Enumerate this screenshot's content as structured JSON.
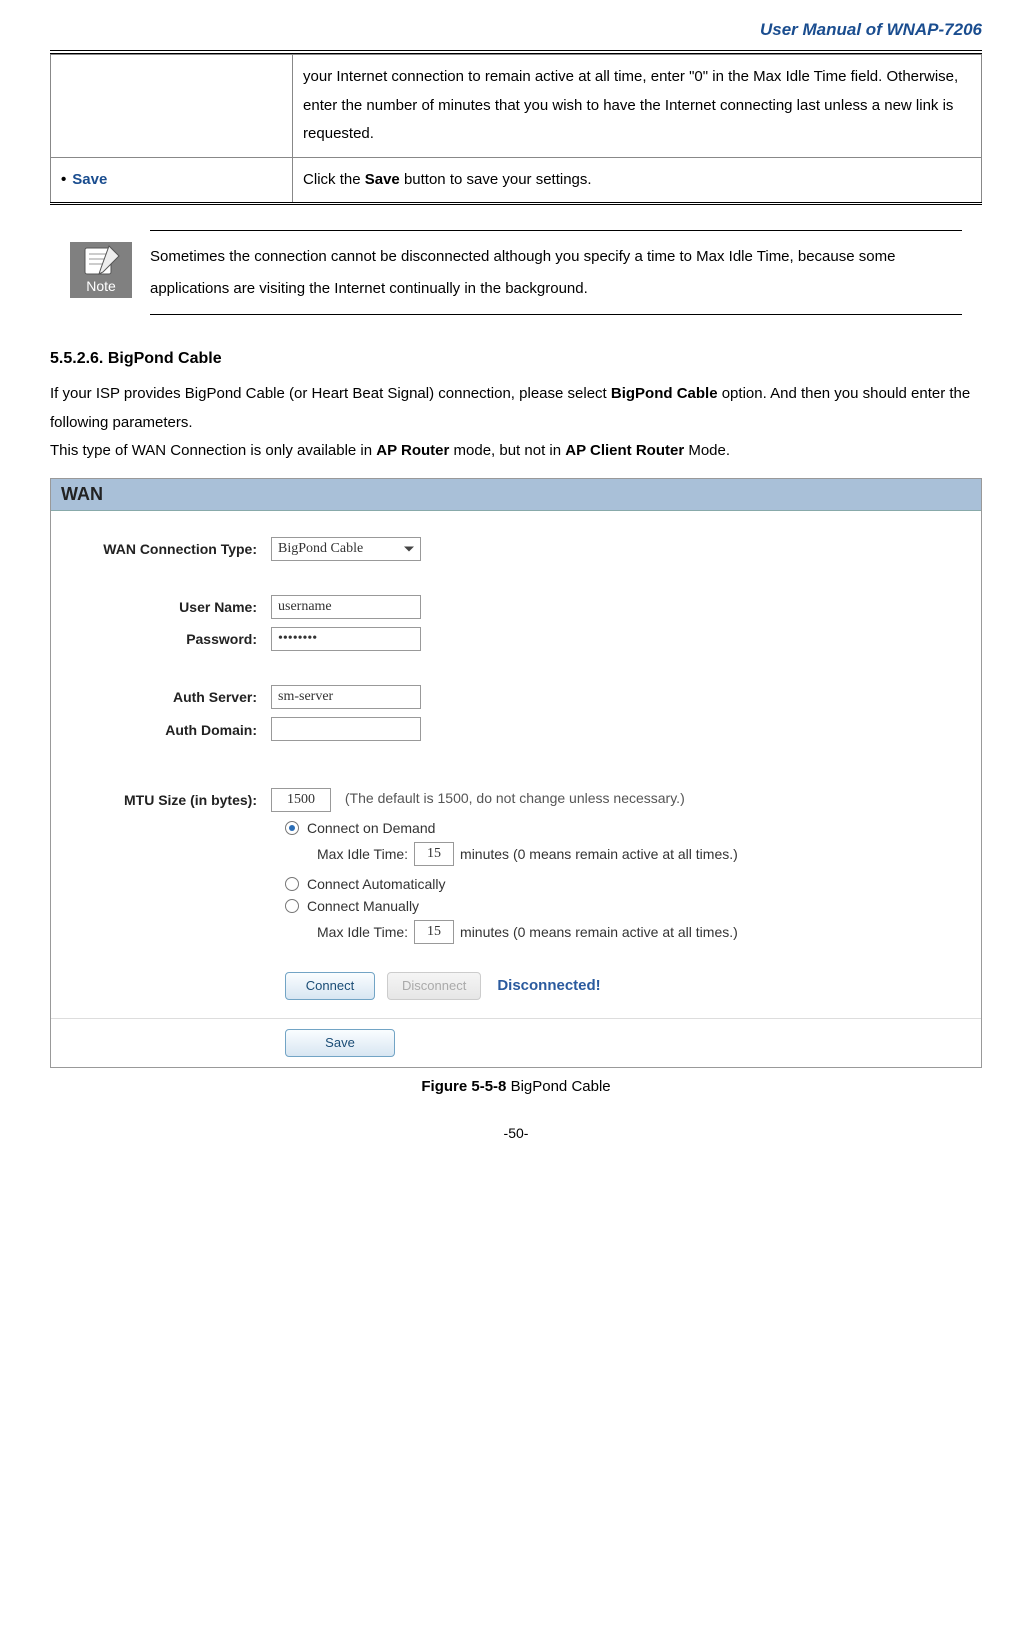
{
  "header": {
    "title": "User Manual of WNAP-7206"
  },
  "param_table": {
    "row1_desc": "your Internet connection to remain active at all time, enter \"0\" in the Max Idle Time field. Otherwise, enter the number of minutes that you wish to have the Internet connecting last unless a new link is requested.",
    "row2_label": "Save",
    "row2_desc_before": "Click the ",
    "row2_desc_bold": "Save",
    "row2_desc_after": " button to save your settings."
  },
  "note": {
    "label": "Note",
    "text": "Sometimes the connection cannot be disconnected although you specify a time to Max Idle Time, because some applications are visiting the Internet continually in the background."
  },
  "section": {
    "number": "5.5.2.6.",
    "title": "BigPond Cable",
    "p1_before": "If your ISP provides BigPond Cable (or Heart Beat Signal) connection, please select ",
    "p1_bold": "BigPond Cable",
    "p1_after": " option. And then you should enter the following parameters.",
    "p2_before": "This type of WAN Connection is only available in ",
    "p2_bold1": "AP Router",
    "p2_mid": " mode, but not in ",
    "p2_bold2": "AP Client Router",
    "p2_after": " Mode."
  },
  "wan": {
    "panel_title": "WAN",
    "conn_type_label": "WAN Connection Type:",
    "conn_type_value": "BigPond Cable",
    "user_label": "User Name:",
    "user_value": "username",
    "pass_label": "Password:",
    "pass_value": "••••••••",
    "authserver_label": "Auth Server:",
    "authserver_value": "sm-server",
    "authdomain_label": "Auth Domain:",
    "authdomain_value": "",
    "mtu_label": "MTU Size (in bytes):",
    "mtu_value": "1500",
    "mtu_note": "(The default is 1500, do not change unless necessary.)",
    "radio_demand": "Connect on Demand",
    "radio_auto": "Connect Automatically",
    "radio_manual": "Connect Manually",
    "idle_label": "Max Idle Time:",
    "idle_value1": "15",
    "idle_value2": "15",
    "idle_suffix": "minutes (0 means remain active at all times.)",
    "connect_btn": "Connect",
    "disconnect_btn": "Disconnect",
    "status": "Disconnected!",
    "save_btn": "Save"
  },
  "figure": {
    "label": "Figure 5-5-8",
    "caption": "BigPond Cable"
  },
  "page_number": "-50-"
}
